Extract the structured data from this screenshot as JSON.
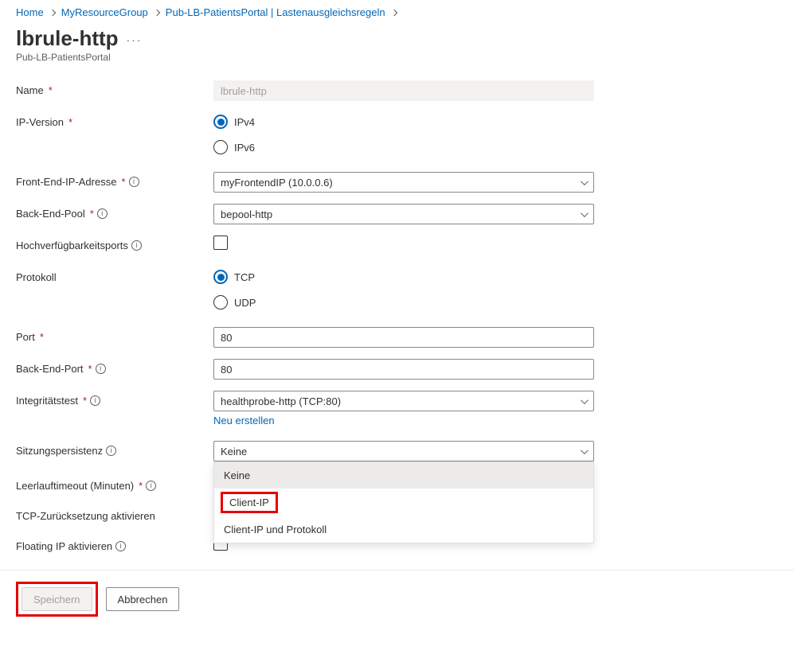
{
  "breadcrumb": [
    {
      "label": "Home"
    },
    {
      "label": "MyResourceGroup"
    },
    {
      "label": "Pub-LB-PatientsPortal | Lastenausgleichsregeln"
    }
  ],
  "title": "lbrule-http",
  "subtitle": "Pub-LB-PatientsPortal",
  "fields": {
    "name": {
      "label": "Name",
      "value": "lbrule-http"
    },
    "ipVersion": {
      "label": "IP-Version",
      "options": [
        {
          "label": "IPv4",
          "checked": true
        },
        {
          "label": "IPv6",
          "checked": false
        }
      ]
    },
    "frontendIp": {
      "label": "Front-End-IP-Adresse",
      "value": "myFrontendIP (10.0.0.6)"
    },
    "backendPool": {
      "label": "Back-End-Pool",
      "value": "bepool-http"
    },
    "haPorts": {
      "label": "Hochverfügbarkeitsports"
    },
    "protocol": {
      "label": "Protokoll",
      "options": [
        {
          "label": "TCP",
          "checked": true
        },
        {
          "label": "UDP",
          "checked": false
        }
      ]
    },
    "port": {
      "label": "Port",
      "value": "80"
    },
    "backendPort": {
      "label": "Back-End-Port",
      "value": "80"
    },
    "healthProbe": {
      "label": "Integritätstest",
      "value": "healthprobe-http (TCP:80)",
      "createNew": "Neu erstellen"
    },
    "sessionPersistence": {
      "label": "Sitzungspersistenz",
      "value": "Keine",
      "options": [
        "Keine",
        "Client-IP",
        "Client-IP und Protokoll"
      ]
    },
    "idleTimeout": {
      "label": "Leerlauftimeout (Minuten)"
    },
    "tcpReset": {
      "label": "TCP-Zurücksetzung aktivieren"
    },
    "floatingIp": {
      "label": "Floating IP aktivieren"
    }
  },
  "footer": {
    "save": "Speichern",
    "cancel": "Abbrechen"
  }
}
